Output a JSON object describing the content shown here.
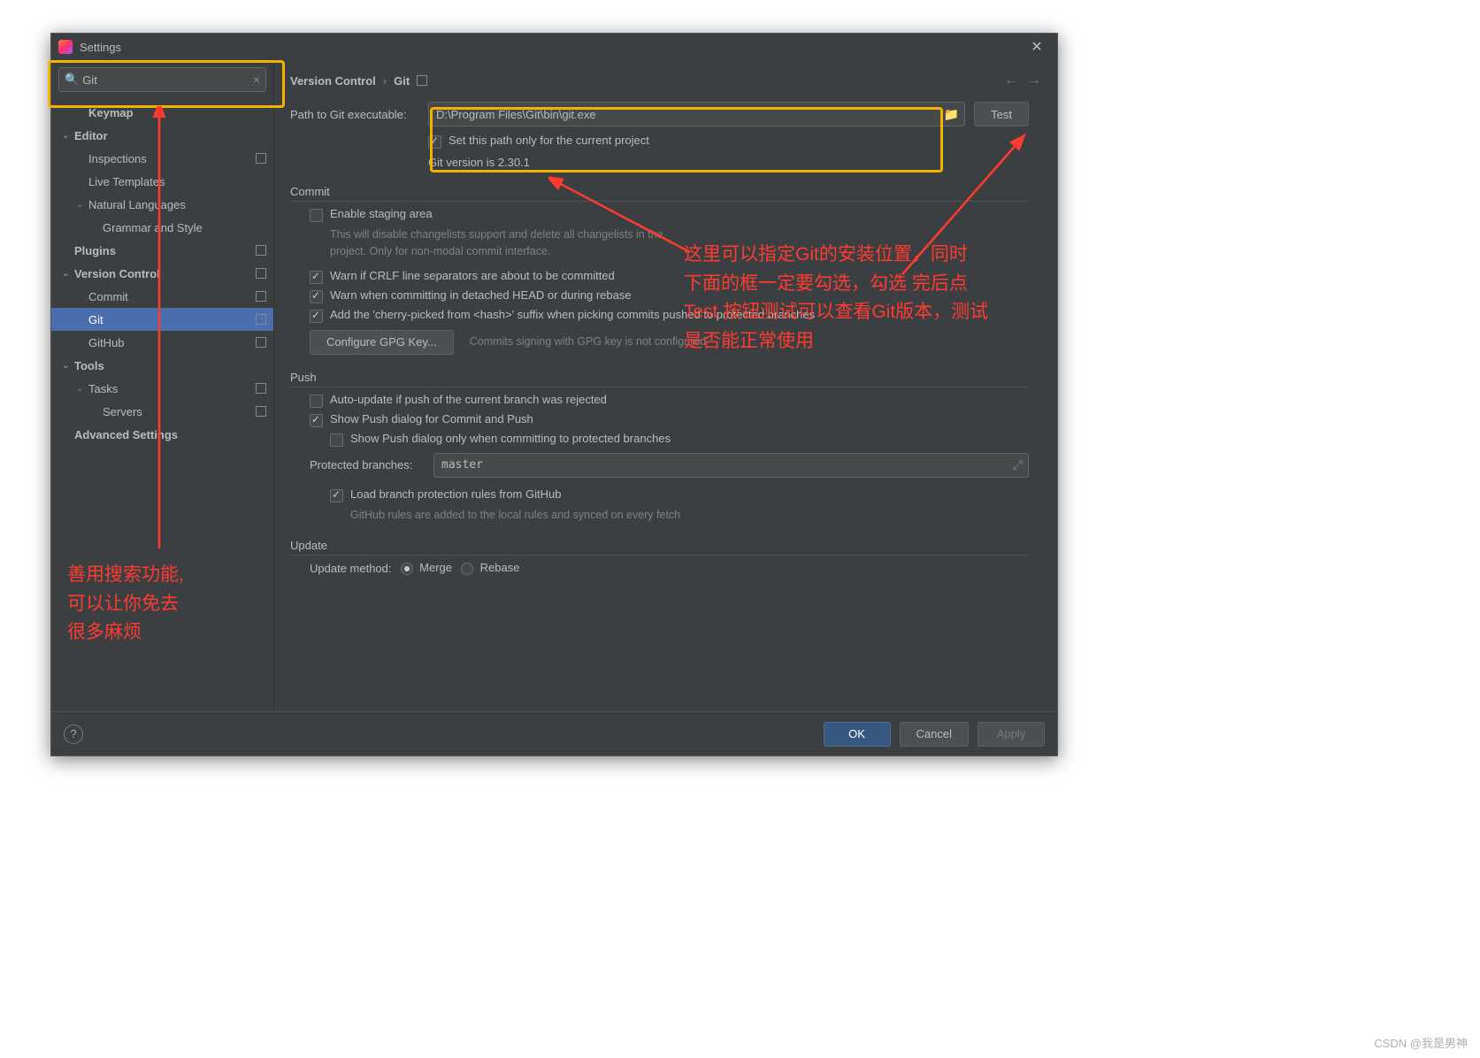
{
  "window": {
    "title": "Settings"
  },
  "search": {
    "value": "Git"
  },
  "sidebar": {
    "items": [
      {
        "label": "Keymap",
        "ind": 1,
        "bold": true
      },
      {
        "label": "Editor",
        "ind": 0,
        "bold": true,
        "chev": "v"
      },
      {
        "label": "Inspections",
        "ind": 1,
        "proj": true
      },
      {
        "label": "Live Templates",
        "ind": 1
      },
      {
        "label": "Natural Languages",
        "ind": 1,
        "chev": "v"
      },
      {
        "label": "Grammar and Style",
        "ind": 2
      },
      {
        "label": "Plugins",
        "ind": 0,
        "bold": true,
        "proj": true
      },
      {
        "label": "Version Control",
        "ind": 0,
        "bold": true,
        "chev": "v",
        "proj": true
      },
      {
        "label": "Commit",
        "ind": 1,
        "proj": true
      },
      {
        "label": "Git",
        "ind": 1,
        "proj": true,
        "selected": true
      },
      {
        "label": "GitHub",
        "ind": 1,
        "proj": true
      },
      {
        "label": "Tools",
        "ind": 0,
        "bold": true,
        "chev": "v"
      },
      {
        "label": "Tasks",
        "ind": 1,
        "chev": "v",
        "proj": true
      },
      {
        "label": "Servers",
        "ind": 2,
        "proj": true
      },
      {
        "label": "Advanced Settings",
        "ind": 0,
        "bold": true
      }
    ]
  },
  "breadcrumb": {
    "root": "Version Control",
    "leaf": "Git"
  },
  "git": {
    "path_label": "Path to Git executable:",
    "path_value": "D:\\Program Files\\Git\\bin\\git.exe",
    "project_only_label": "Set this path only for the current project",
    "version_text": "Git version is 2.30.1",
    "test_btn": "Test"
  },
  "commit": {
    "header": "Commit",
    "enable_staging": "Enable staging area",
    "staging_hint": "This will disable changelists support and delete all changelists in the project. Only for non-modal commit interface.",
    "warn_crlf": "Warn if CRLF line separators are about to be committed",
    "warn_detached": "Warn when committing in detached HEAD or during rebase",
    "cherry_suffix": "Add the 'cherry-picked from <hash>' suffix when picking commits pushed to protected branches",
    "gpg_btn": "Configure GPG Key...",
    "gpg_hint": "Commits signing with GPG key is not configured"
  },
  "push": {
    "header": "Push",
    "auto_update": "Auto-update if push of the current branch was rejected",
    "show_dialog": "Show Push dialog for Commit and Push",
    "show_dialog_protected": "Show Push dialog only when committing to protected branches",
    "protected_label": "Protected branches:",
    "protected_value": "master",
    "load_rules": "Load branch protection rules from GitHub",
    "rules_hint": "GitHub rules are added to the local rules and synced on every fetch"
  },
  "update": {
    "header": "Update",
    "method_label": "Update method:",
    "merge": "Merge",
    "rebase": "Rebase"
  },
  "footer": {
    "ok": "OK",
    "cancel": "Cancel",
    "apply": "Apply"
  },
  "annotations": {
    "left": "善用搜索功能,\n可以让你免去\n很多麻烦",
    "right": "这里可以指定Git的安装位置，同时\n下面的框一定要勾选，勾选 完后点\nTest 按钮测试可以查看Git版本，测试\n是否能正常使用"
  },
  "watermark": "CSDN @我是男神"
}
